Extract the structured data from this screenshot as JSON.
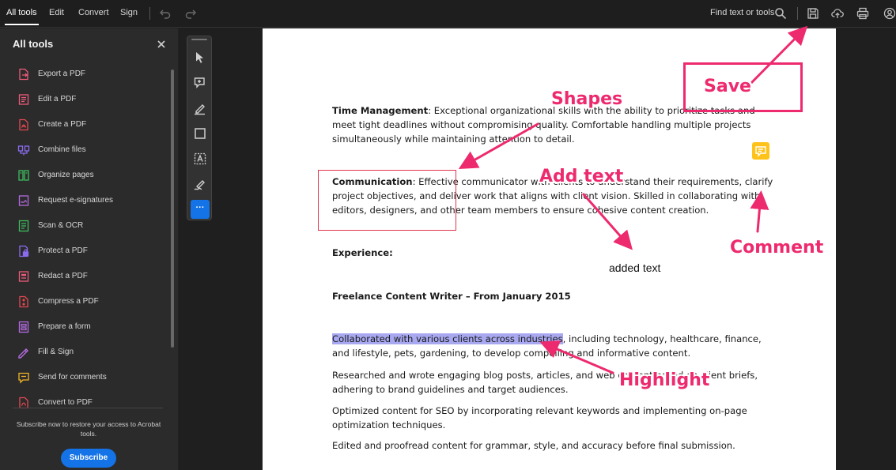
{
  "topbar": {
    "tabs": [
      {
        "label": "All tools"
      },
      {
        "label": "Edit"
      },
      {
        "label": "Convert"
      },
      {
        "label": "Sign"
      }
    ],
    "search_label": "Find text or tools"
  },
  "left_panel": {
    "title": "All tools",
    "items": [
      {
        "label": "Export a PDF",
        "icon": "export-pdf-icon",
        "color": "#ec5b7a"
      },
      {
        "label": "Edit a PDF",
        "icon": "edit-pdf-icon",
        "color": "#ec5b7a"
      },
      {
        "label": "Create a PDF",
        "icon": "create-pdf-icon",
        "color": "#e34850"
      },
      {
        "label": "Combine files",
        "icon": "combine-files-icon",
        "color": "#8a6cf0"
      },
      {
        "label": "Organize pages",
        "icon": "organize-pages-icon",
        "color": "#3dbd5c"
      },
      {
        "label": "Request e-signatures",
        "icon": "request-esign-icon",
        "color": "#b26be0"
      },
      {
        "label": "Scan & OCR",
        "icon": "scan-ocr-icon",
        "color": "#3dbd5c"
      },
      {
        "label": "Protect a PDF",
        "icon": "protect-pdf-icon",
        "color": "#8a6cf0"
      },
      {
        "label": "Redact a PDF",
        "icon": "redact-pdf-icon",
        "color": "#ec5b7a"
      },
      {
        "label": "Compress a PDF",
        "icon": "compress-pdf-icon",
        "color": "#e34850"
      },
      {
        "label": "Prepare a form",
        "icon": "prepare-form-icon",
        "color": "#b26be0"
      },
      {
        "label": "Fill & Sign",
        "icon": "fill-sign-icon",
        "color": "#b26be0"
      },
      {
        "label": "Send for comments",
        "icon": "send-comments-icon",
        "color": "#f0b429"
      },
      {
        "label": "Convert to PDF",
        "icon": "convert-to-pdf-icon",
        "color": "#e34850"
      }
    ],
    "subscribe_message": "Subscribe now to restore your access to Acrobat tools.",
    "subscribe_label": "Subscribe"
  },
  "quick_tools": {
    "more_label": "···"
  },
  "document": {
    "p1_label": "Time Management",
    "p1_text": ": Exceptional organizational skills with the ability to prioritize tasks and meet tight deadlines without compromising quality. Comfortable handling multiple projects simultaneously while maintaining attention to detail.",
    "p2_label": "Communication",
    "p2_text": ": Effective communicator with clients to understand their requirements, clarify project objectives, and deliver work that aligns with client vision. Skilled in collaborating with editors, designers, and other team members to ensure cohesive content creation.",
    "experience_heading": "Experience:",
    "added_text": "added text",
    "job_heading": "Freelance Content Writer – From January 2015",
    "p3_highlight": "Collaborated with various clients across industries",
    "p3_rest": ", including technology, healthcare, finance, and lifestyle, pets, gardening, to develop compelling and informative content.",
    "p4": "Researched and wrote engaging blog posts, articles, and web content based on client briefs, adhering to brand guidelines and target audiences.",
    "p5": "Optimized content for SEO by incorporating relevant keywords and implementing on-page optimization techniques.",
    "p6": "Edited and proofread content for grammar, style, and accuracy before final submission."
  },
  "annotations": {
    "save": "Save",
    "shapes": "Shapes",
    "add_text": "Add text",
    "comment": "Comment",
    "highlight": "Highlight",
    "color": "#ee2a6f"
  }
}
